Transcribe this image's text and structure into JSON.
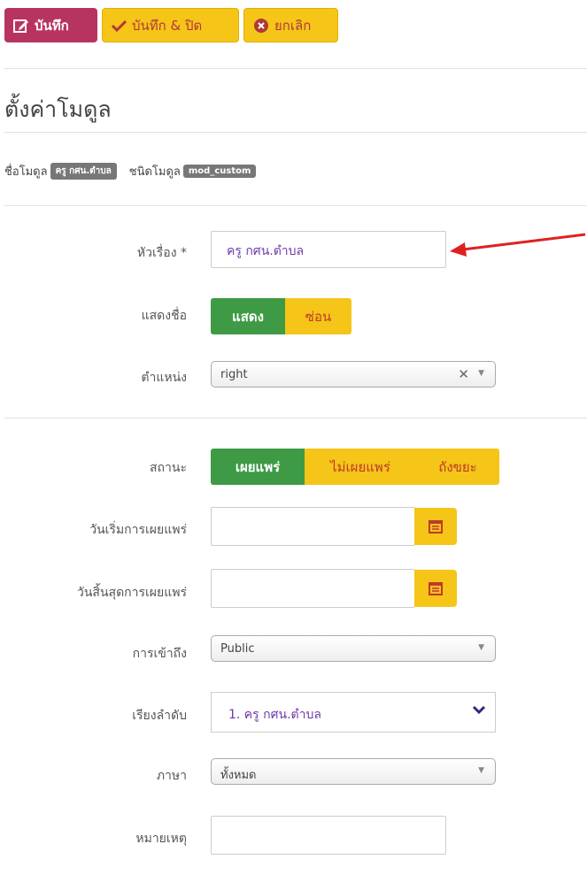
{
  "toolbar": {
    "save_label": "บันทึก",
    "save_close_label": "บันทึก & ปิด",
    "cancel_label": "ยกเลิก"
  },
  "page_title": "ตั้งค่าโมดูล",
  "meta": {
    "module_name_label": "ชื่อโมดูล",
    "module_name_value": "ครู กศน.ตำบล",
    "module_type_label": "ชนิดโมดูล",
    "module_type_value": "mod_custom"
  },
  "form": {
    "title_label": "หัวเรื่อง *",
    "title_value": "ครู กศน.ตำบล",
    "show_title_label": "แสดงชื่อ",
    "show_title_options": [
      "แสดง",
      "ซ่อน"
    ],
    "position_label": "ตำแหน่ง",
    "position_value": "right",
    "status_label": "สถานะ",
    "status_options": [
      "เผยแพร่",
      "ไม่เผยแพร่",
      "ถังขยะ"
    ],
    "publish_start_label": "วันเริ่มการเผยแพร่",
    "publish_end_label": "วันสิ้นสุดการเผยแพร่",
    "access_label": "การเข้าถึง",
    "access_value": "Public",
    "ordering_label": "เรียงลำดับ",
    "ordering_value": "1. ครู กศน.ตำบล",
    "language_label": "ภาษา",
    "language_value": "ทั้งหมด",
    "note_label": "หมายเหตุ"
  },
  "colors": {
    "save": "#b83460",
    "warning": "#f5c518",
    "success": "#3e9a45",
    "annotation_arrow": "#e02020"
  }
}
